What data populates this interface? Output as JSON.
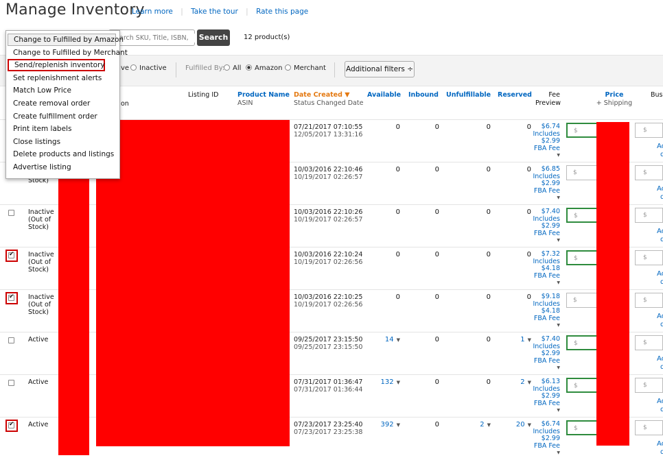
{
  "title": "Manage Inventory",
  "header_links": [
    "Learn more",
    "Take the tour",
    "Rate this page"
  ],
  "search": {
    "placeholder": "Search SKU, Title, ISBN,",
    "visible_placeholder": "arch SKU, Title, ISBN,",
    "button": "Search"
  },
  "product_count": "12 product(s)",
  "filters": {
    "status_partial": "ve",
    "status_inactive": "Inactive",
    "fulfilled_by_label": "Fulfilled By:",
    "fulfilled_all": "All",
    "fulfilled_amazon": "Amazon",
    "fulfilled_merchant": "Merchant",
    "fulfilled_selected": "Amazon",
    "additional": "Additional filters ÷"
  },
  "columns": {
    "condition_partial": "on",
    "listing_id": "Listing ID",
    "product_name": "Product Name",
    "asin": "ASIN",
    "date_created": "Date Created ▼",
    "status_changed": "Status Changed Date",
    "available": "Available",
    "inbound": "Inbound",
    "unfulfillable": "Unfulfillable",
    "reserved": "Reserved",
    "fee_1": "Fee",
    "fee_2": "Preview",
    "price": "Price",
    "shipping": "+ Shipping",
    "business_partial": "Bus"
  },
  "menu": {
    "items": [
      "Change to Fulfilled by Amazon",
      "Change to Fulfilled by Merchant",
      "Send/replenish inventory",
      "Set replenishment alerts",
      "Match Low Price",
      "Create removal order",
      "Create fulfillment order",
      "Print item labels",
      "Close listings",
      "Delete products and listings",
      "Advertise listing"
    ],
    "highlighted": "Send/replenish inventory"
  },
  "rows": [
    {
      "checked": false,
      "status": [
        "",
        "",
        ""
      ],
      "created": "07/21/2017 07:10:55",
      "changed": "12/05/2017 13:31:16",
      "available": "0",
      "inbound": "0",
      "unfulfillable": "0",
      "reserved": "0",
      "fee": "$6.74",
      "fba": "$2.99",
      "price_highlight": true
    },
    {
      "checked": false,
      "status": [
        "Stock)",
        "",
        ""
      ],
      "created": "10/03/2016 22:10:46",
      "changed": "10/19/2017 02:26:57",
      "available": "0",
      "inbound": "0",
      "unfulfillable": "0",
      "reserved": "0",
      "fee": "$6.85",
      "fba": "$2.99",
      "price_highlight": false
    },
    {
      "checked": false,
      "status": [
        "Inactive",
        "(Out of",
        "Stock)"
      ],
      "created": "10/03/2016 22:10:26",
      "changed": "10/19/2017 02:26:57",
      "available": "0",
      "inbound": "0",
      "unfulfillable": "0",
      "reserved": "0",
      "fee": "$7.40",
      "fba": "$2.99",
      "price_highlight": true
    },
    {
      "checked": true,
      "status": [
        "Inactive",
        "(Out of",
        "Stock)"
      ],
      "created": "10/03/2016 22:10:24",
      "changed": "10/19/2017 02:26:56",
      "available": "0",
      "inbound": "0",
      "unfulfillable": "0",
      "reserved": "0",
      "fee": "$7.32",
      "fba": "$4.18",
      "price_highlight": true
    },
    {
      "checked": true,
      "status": [
        "Inactive",
        "(Out of",
        "Stock)"
      ],
      "created": "10/03/2016 22:10:25",
      "changed": "10/19/2017 02:26:56",
      "available": "0",
      "inbound": "0",
      "unfulfillable": "0",
      "reserved": "0",
      "fee": "$9.18",
      "fba": "$4.18",
      "price_highlight": false
    },
    {
      "checked": false,
      "status": [
        "Active",
        "",
        ""
      ],
      "created": "09/25/2017 23:15:50",
      "changed": "09/25/2017 23:15:50",
      "available": "14",
      "inbound": "0",
      "unfulfillable": "0",
      "reserved": "1",
      "fee": "$7.40",
      "fba": "$2.99",
      "price_highlight": true
    },
    {
      "checked": false,
      "status": [
        "Active",
        "",
        ""
      ],
      "created": "07/31/2017 01:36:47",
      "changed": "07/31/2017 01:36:44",
      "available": "132",
      "inbound": "0",
      "unfulfillable": "0",
      "reserved": "2",
      "fee": "$6.13",
      "fba": "$2.99",
      "price_highlight": true
    },
    {
      "checked": true,
      "status": [
        "Active",
        "",
        ""
      ],
      "created": "07/23/2017 23:25:40",
      "changed": "07/23/2017 23:25:38",
      "available": "392",
      "inbound": "0",
      "unfulfillable": "2",
      "reserved": "20",
      "fee": "$6.74",
      "fba": "$2.99",
      "price_highlight": true
    }
  ],
  "labels": {
    "includes": "Includes",
    "fba_fee": "FBA Fee",
    "currency": "$",
    "biz_add_1": "Ac",
    "biz_add_2": "d"
  }
}
